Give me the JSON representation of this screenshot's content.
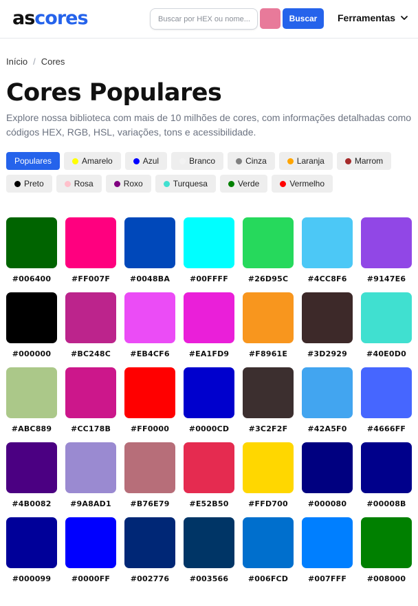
{
  "header": {
    "logo_part1": "as",
    "logo_part2": "cores",
    "search_placeholder": "Buscar por HEX ou nome...",
    "picker_color": "#E87A9A",
    "search_button": "Buscar",
    "tools_label": "Ferramentas"
  },
  "breadcrumb": {
    "home": "Início",
    "separator": "/",
    "current": "Cores"
  },
  "page": {
    "title": "Cores Populares",
    "description": "Explore nossa biblioteca com mais de 10 milhões de cores, com informações detalhadas como códigos HEX, RGB, HSL, variações, tons e acessibilidade."
  },
  "filters": [
    {
      "label": "Populares",
      "dot": null,
      "active": true
    },
    {
      "label": "Amarelo",
      "dot": "#FFFF00"
    },
    {
      "label": "Azul",
      "dot": "#0000FF"
    },
    {
      "label": "Branco",
      "dot": "#F2F2F2"
    },
    {
      "label": "Cinza",
      "dot": "#808080"
    },
    {
      "label": "Laranja",
      "dot": "#FFA500"
    },
    {
      "label": "Marrom",
      "dot": "#A52A2A"
    },
    {
      "label": "Preto",
      "dot": "#000000"
    },
    {
      "label": "Rosa",
      "dot": "#FFC0CB"
    },
    {
      "label": "Roxo",
      "dot": "#800080"
    },
    {
      "label": "Turquesa",
      "dot": "#40E0D0"
    },
    {
      "label": "Verde",
      "dot": "#008000"
    },
    {
      "label": "Vermelho",
      "dot": "#FF0000"
    }
  ],
  "colors": [
    "#006400",
    "#FF007F",
    "#0048BA",
    "#00FFFF",
    "#26D95C",
    "#4CC8F6",
    "#9147E6",
    "#000000",
    "#BC248C",
    "#EB4CF6",
    "#EA1FD9",
    "#F8961E",
    "#3D2929",
    "#40E0D0",
    "#ABC889",
    "#CC178B",
    "#FF0000",
    "#0000CD",
    "#3C2F2F",
    "#42A5F0",
    "#4666FF",
    "#4B0082",
    "#9A8AD1",
    "#B76E79",
    "#E52B50",
    "#FFD700",
    "#000080",
    "#00008B",
    "#000099",
    "#0000FF",
    "#002776",
    "#003566",
    "#006FCD",
    "#007FFF",
    "#008000"
  ]
}
